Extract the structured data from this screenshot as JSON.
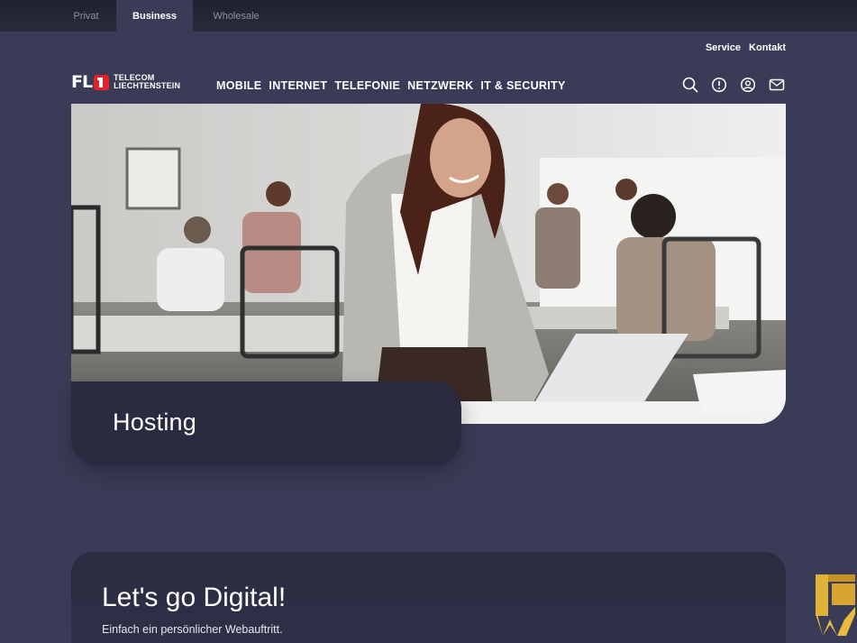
{
  "segments": {
    "privat": "Privat",
    "business": "Business",
    "wholesale": "Wholesale"
  },
  "header": {
    "service": "Service",
    "kontakt": "Kontakt",
    "logo": {
      "mark": "FL",
      "line1": "TELECOM",
      "line2": "LIECHTENSTEIN"
    },
    "nav": [
      "MOBILE",
      "INTERNET",
      "TELEFONIE",
      "NETZWERK",
      "IT & SECURITY"
    ],
    "icons": [
      "search-icon",
      "info-icon",
      "user-icon",
      "mail-icon"
    ]
  },
  "hero": {
    "title": "Hosting"
  },
  "digital": {
    "title": "Let's go Digital!",
    "subtitle": "Einfach ein persönlicher Webauftritt."
  },
  "colors": {
    "background": "#3a3c57",
    "topbar": "#22232f",
    "card": "#2a2b40",
    "brand_red": "#e2212b"
  }
}
